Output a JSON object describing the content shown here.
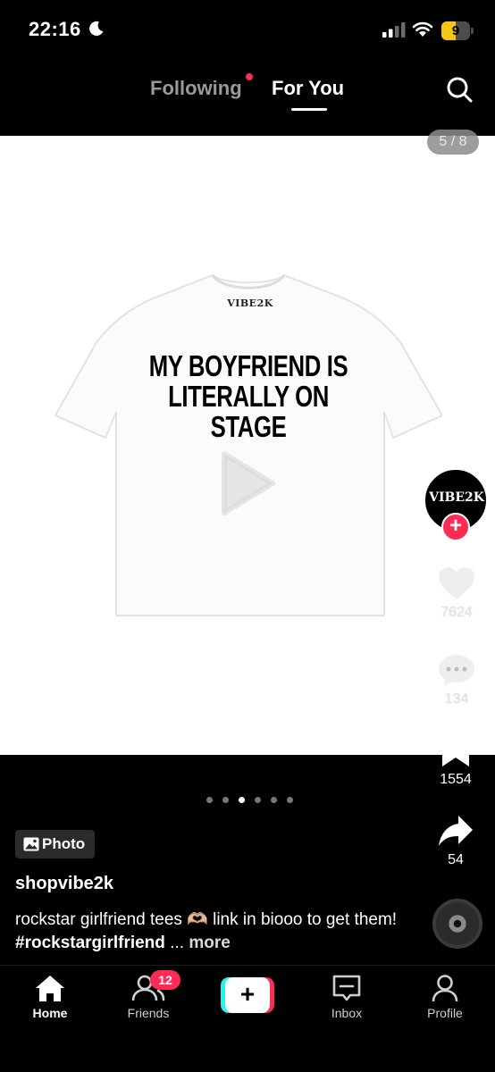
{
  "status_bar": {
    "time": "22:16",
    "battery": "9"
  },
  "top_nav": {
    "following_label": "Following",
    "for_you_label": "For You"
  },
  "media": {
    "page_counter": "5 / 8",
    "tee_brand": "VIBE2K",
    "tee_text": "MY BOYFRIEND IS LITERALLY ON STAGE"
  },
  "creator": {
    "avatar_text": "VIBE2K"
  },
  "actions": {
    "likes": "7624",
    "comments": "134",
    "saves": "1554",
    "shares": "54"
  },
  "carousel": {
    "total": 6,
    "active_index": 2
  },
  "post": {
    "type_label": "Photo",
    "username": "shopvibe2k",
    "caption": "rockstar girlfriend tees 🫶🏼 link in biooo to get them!",
    "hashtag": "#rockstargirlfriend",
    "ellipsis": " ...",
    "more_label": "more"
  },
  "tab_bar": {
    "home_label": "Home",
    "friends_label": "Friends",
    "friends_badge": "12",
    "inbox_label": "Inbox",
    "profile_label": "Profile"
  },
  "colors": {
    "accent": "#fe2c55",
    "cyan": "#25f4ee",
    "background": "#000000"
  }
}
